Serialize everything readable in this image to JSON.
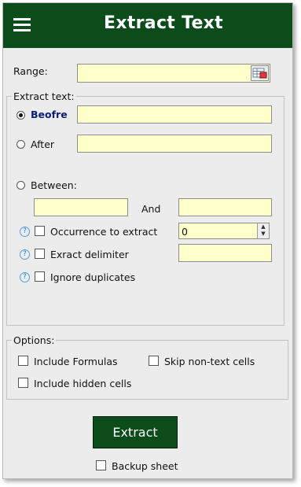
{
  "header": {
    "title": "Extract Text",
    "menu_icon": "hamburger-menu-icon",
    "background_color": "#0b4c1a"
  },
  "range": {
    "label": "Range:",
    "value": "",
    "select_icon": "range-select-icon"
  },
  "extract_text": {
    "legend": "Extract text:",
    "before_label": "Beofre",
    "before_value": "",
    "after_label": "After",
    "after_value": "",
    "between_label": "Between:",
    "between_from_value": "",
    "and_label": "And",
    "between_to_value": "",
    "selected_mode": "Beofre",
    "occurrence_label": "Occurrence to extract",
    "occurrence_value": "0",
    "delimiter_label": "Exract delimiter",
    "delimiter_value": "",
    "ignore_duplicates_label": "Ignore duplicates",
    "help_icon": "help-question-icon"
  },
  "options": {
    "legend": "Options:",
    "include_formulas": "Include Formulas",
    "skip_non_text": "Skip non-text cells",
    "include_hidden": "Include hidden cells"
  },
  "actions": {
    "extract_label": "Extract",
    "backup_label": "Backup sheet"
  },
  "colors": {
    "field_background": "#ffffcc",
    "panel_background": "#ececec",
    "selected_label": "#0a1f7a"
  }
}
